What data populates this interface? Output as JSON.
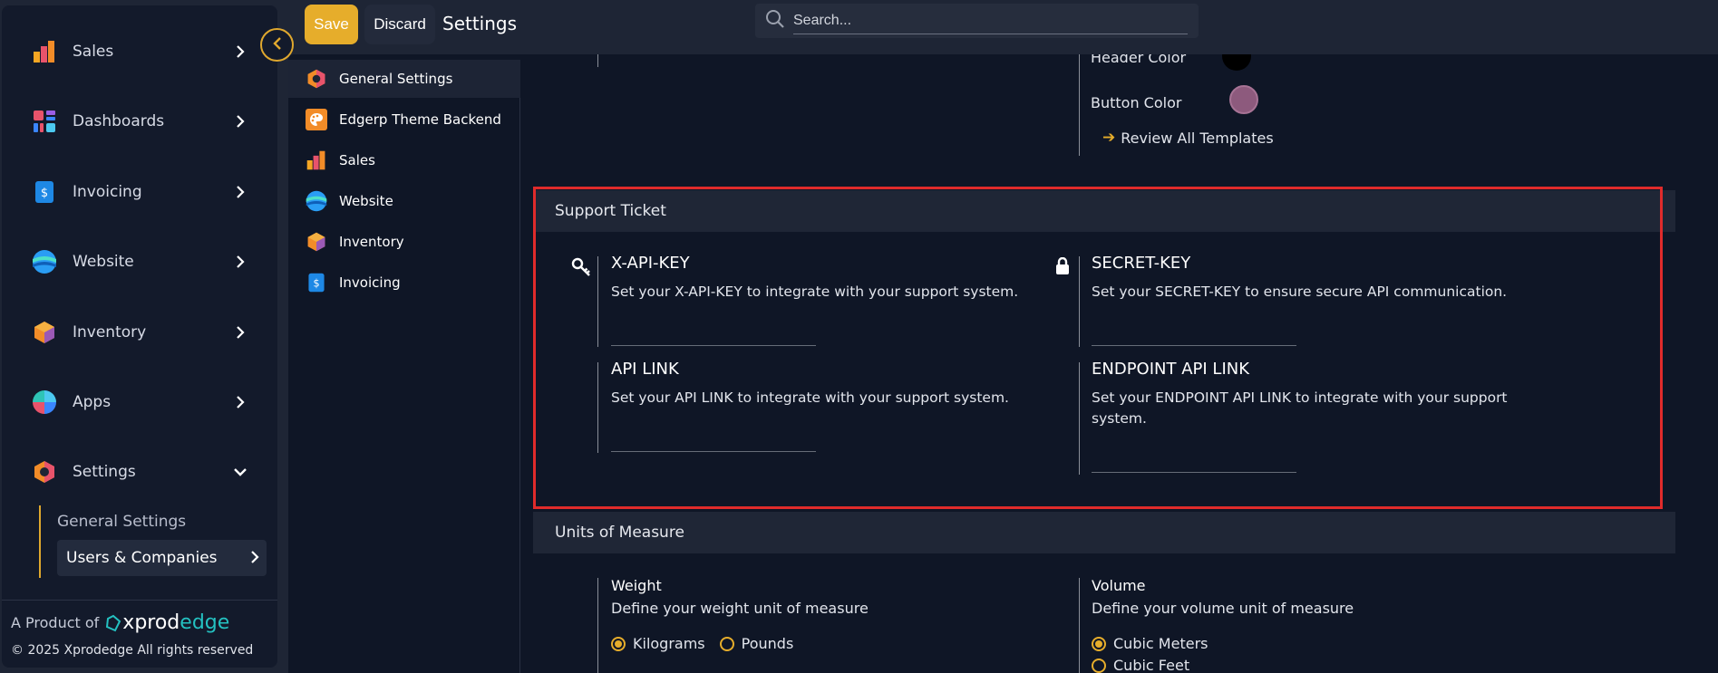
{
  "topbar": {
    "save_label": "Save",
    "discard_label": "Discard",
    "title": "Settings",
    "search_placeholder": "Search..."
  },
  "sidebar": {
    "items": [
      {
        "label": "Sales",
        "icon": "bar-chart-icon"
      },
      {
        "label": "Dashboards",
        "icon": "dashboard-grid-icon"
      },
      {
        "label": "Invoicing",
        "icon": "invoice-dollar-icon"
      },
      {
        "label": "Website",
        "icon": "globe-waves-icon"
      },
      {
        "label": "Inventory",
        "icon": "cube-icon"
      },
      {
        "label": "Apps",
        "icon": "apps-pie-icon"
      },
      {
        "label": "Settings",
        "icon": "hexagon-gear-icon"
      }
    ],
    "submenu": {
      "general": "General Settings",
      "users": "Users & Companies"
    },
    "footer": {
      "product_of": "A Product of",
      "brand_part1": "xprod",
      "brand_part2": "edge",
      "copyright": "© 2025 Xprodedge All rights reserved"
    }
  },
  "settings_nav": [
    {
      "label": "General Settings",
      "active": true
    },
    {
      "label": "Edgerp Theme Backend",
      "active": false
    },
    {
      "label": "Sales",
      "active": false
    },
    {
      "label": "Website",
      "active": false
    },
    {
      "label": "Inventory",
      "active": false
    },
    {
      "label": "Invoicing",
      "active": false
    }
  ],
  "theme": {
    "header_color_label": "Header Color",
    "button_color_label": "Button Color",
    "header_color": "#000000",
    "button_color": "#8d5a7d",
    "review_link": "Review All Templates"
  },
  "support_ticket": {
    "title": "Support Ticket",
    "fields": [
      {
        "title": "X-API-KEY",
        "desc": "Set your X-API-KEY to integrate with your support system.",
        "icon": "key-icon"
      },
      {
        "title": "SECRET-KEY",
        "desc": "Set your SECRET-KEY to ensure secure API communication.",
        "icon": "lock-icon"
      },
      {
        "title": "API LINK",
        "desc": "Set your API LINK to integrate with your support system."
      },
      {
        "title": "ENDPOINT API LINK",
        "desc": "Set your ENDPOINT API LINK to integrate with your support system."
      }
    ]
  },
  "units": {
    "title": "Units of Measure",
    "weight": {
      "title": "Weight",
      "desc": "Define your weight unit of measure",
      "options": [
        "Kilograms",
        "Pounds"
      ],
      "selected": "Kilograms"
    },
    "volume": {
      "title": "Volume",
      "desc": "Define your volume unit of measure",
      "options": [
        "Cubic Meters",
        "Cubic Feet"
      ],
      "selected": "Cubic Meters"
    }
  },
  "colors": {
    "accent": "#e6ad2b",
    "highlight": "#e02b2b",
    "brand_teal": "#24c1c1"
  }
}
